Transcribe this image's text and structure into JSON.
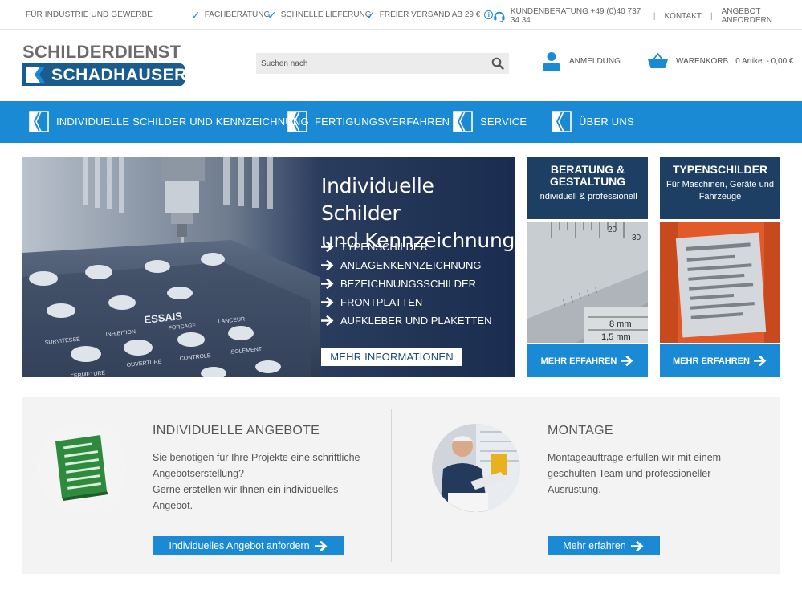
{
  "topbar": {
    "tagline": "FÜR INDUSTRIE UND GEWERBE",
    "usps": [
      "FACHBERATUNG",
      "SCHNELLE LIEFERUNG",
      "FREIER VERSAND AB 29 €"
    ],
    "hotline": "KUNDENBERATUNG +49 (0)40 737 34 34",
    "contact": "KONTAKT",
    "quote": "ANGEBOT ANFORDERN"
  },
  "header": {
    "logo_top": "SCHILDERDIENST",
    "logo_bottom": "SCHADHAUSER",
    "search_placeholder": "Suchen nach",
    "login": "ANMELDUNG",
    "cart_label": "WARENKORB",
    "cart_amount": "0 Artikel - 0,00 €"
  },
  "nav": [
    "INDIVIDUELLE SCHILDER UND KENNZEICHNUNG",
    "FERTIGUNGSVERFAHREN",
    "SERVICE",
    "ÜBER UNS"
  ],
  "hero": {
    "title_line1": "Individuelle Schilder",
    "title_line2": "und Kennzeichnung",
    "items": [
      "TYPENSCHILDER",
      "ANLAGENKENNZEICHNUNG",
      "BEZEICHNUNGSSCHILDER",
      "FRONTPLATTEN",
      "AUFKLEBER UND PLAKETTEN"
    ],
    "button": "MEHR INFORMATIONEN",
    "plate_text": [
      "ESSAIS",
      "SURVITESSE",
      "INHIBITION",
      "FORCAGE",
      "LANCEUR",
      "OUVERTURE",
      "CONTROLE",
      "ISOLEMENT",
      "FERMETURE"
    ]
  },
  "tiles": [
    {
      "title_line1": "BERATUNG &",
      "title_line2": "GESTALTUNG",
      "subtitle": "individuell & professionell",
      "button": "MEHR EFFAHREN"
    },
    {
      "title_line1": "TYPENSCHILDER",
      "subtitle": "Für Maschinen, Geräte und Fahrzeuge",
      "button": "MEHR ERFAHREN"
    }
  ],
  "ruler_numbers": [
    "20",
    "30",
    "8 mm",
    "1,5 mm"
  ],
  "offers": {
    "title": "INDIVIDUELLE ANGEBOTE",
    "text_line1": "Sie benötigen für Ihre Projekte eine schriftliche",
    "text_line2": "Angebotserstellung?",
    "text_line3": "Gerne erstellen wir Ihnen ein individuelles",
    "text_line4": "Angebot.",
    "button": "Individuelles Angebot anfordern"
  },
  "montage": {
    "title": "MONTAGE",
    "text_line1": "Montageaufträge erfüllen wir mit einem",
    "text_line2": "geschulten Team und professioneller",
    "text_line3": "Ausrüstung.",
    "button": "Mehr erfahren"
  },
  "colors": {
    "primary_blue": "#1a8ad4",
    "dark_navy": "#1d3f63",
    "logo_blue": "#1a5c8e"
  }
}
